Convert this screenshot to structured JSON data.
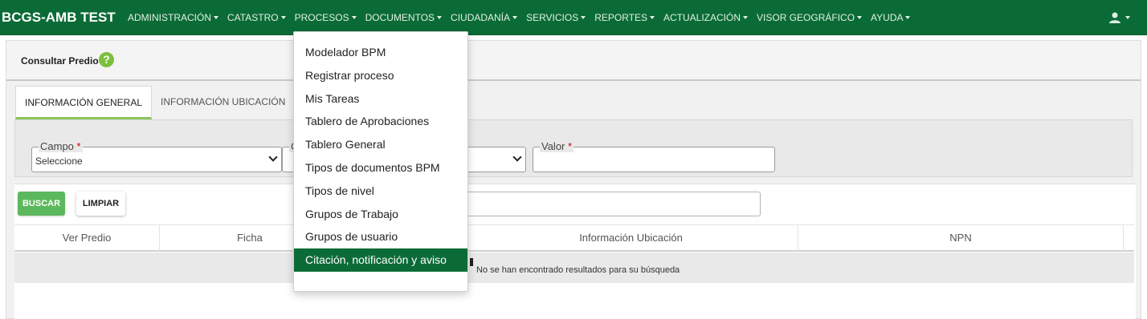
{
  "navbar": {
    "brand": "BCGS-AMB TEST",
    "items": [
      {
        "label": "ADMINISTRACIÓN"
      },
      {
        "label": "CATASTRO"
      },
      {
        "label": "PROCESOS"
      },
      {
        "label": "DOCUMENTOS"
      },
      {
        "label": "CIUDADANÍA"
      },
      {
        "label": "SERVICIOS"
      },
      {
        "label": "REPORTES"
      },
      {
        "label": "ACTUALIZACIÓN"
      },
      {
        "label": "VISOR GEOGRÁFICO"
      },
      {
        "label": "AYUDA"
      }
    ],
    "user_icon": "user-icon"
  },
  "page": {
    "title": "Consultar Predio",
    "help_icon": "help-icon",
    "help_glyph": "?"
  },
  "tabs": [
    {
      "label": "INFORMACIÓN GENERAL",
      "active": true
    },
    {
      "label": "INFORMACIÓN UBICACIÓN",
      "active": false
    }
  ],
  "filters": {
    "campo": {
      "label": "Campo",
      "required_mark": "*",
      "value": "Seleccione"
    },
    "second_field": {
      "label_fragment": "C"
    },
    "valor": {
      "label": "Valor",
      "required_mark": "*",
      "value": ""
    }
  },
  "actions": {
    "buscar": "BUSCAR",
    "limpiar": "LIMPIAR"
  },
  "table": {
    "columns": [
      "Ver Predio",
      "Ficha",
      "Información Ubicación",
      "NPN"
    ],
    "empty_message": "No se han encontrado resultados para su búsqueda"
  },
  "dropdown": {
    "menu": "PROCESOS",
    "items": [
      {
        "label": "Modelador BPM"
      },
      {
        "label": "Registrar proceso"
      },
      {
        "label": "Mis Tareas"
      },
      {
        "label": "Tablero de Aprobaciones"
      },
      {
        "label": "Tablero General"
      },
      {
        "label": "Tipos de documentos BPM"
      },
      {
        "label": "Tipos de nivel"
      },
      {
        "label": "Grupos de Trabajo"
      },
      {
        "label": "Grupos de usuario"
      },
      {
        "label": "Citación, notificación y aviso"
      }
    ],
    "highlighted": "Citación, notificación y aviso"
  },
  "colors": {
    "navbar": "#0b6b36",
    "accent_green": "#5cb85c",
    "tab_underline": "#8ac55a",
    "required": "#cc0000"
  }
}
